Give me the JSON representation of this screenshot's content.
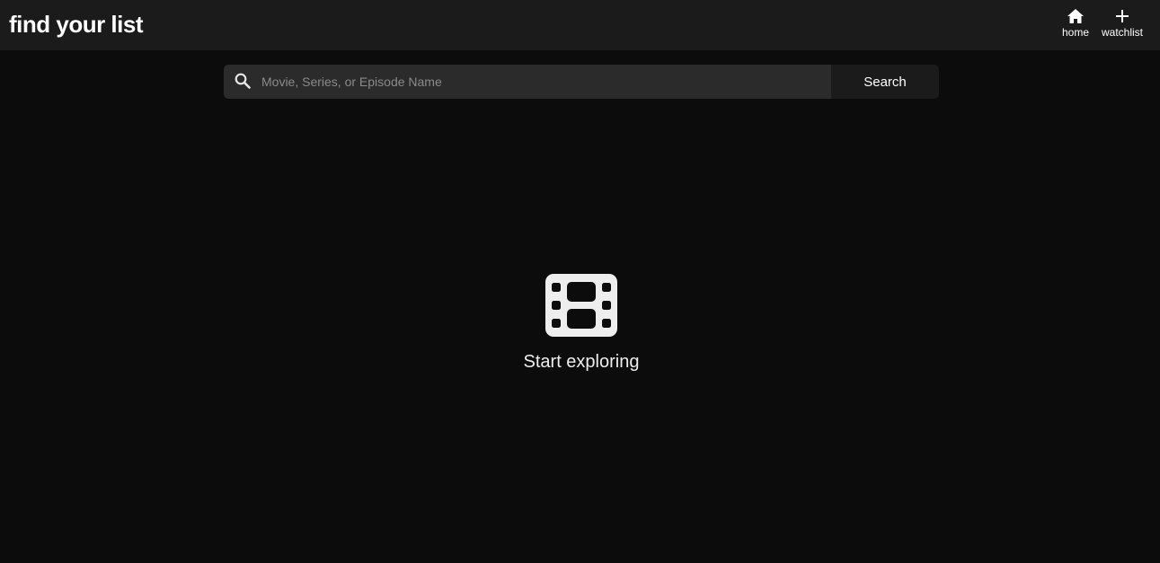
{
  "header": {
    "brand": "find your list",
    "nav": [
      {
        "label": "home",
        "icon": "home-icon"
      },
      {
        "label": "watchlist",
        "icon": "plus-icon"
      }
    ]
  },
  "search": {
    "placeholder": "Movie, Series, or Episode Name",
    "value": "",
    "button_label": "Search",
    "icon": "search-icon"
  },
  "empty_state": {
    "icon": "film-icon",
    "message": "Start exploring"
  },
  "colors": {
    "background": "#0c0c0c",
    "topbar": "#1b1b1b",
    "search_field": "#2b2b2b",
    "search_button": "#1b1b1b",
    "text": "#ffffff",
    "placeholder": "#8a8a8a",
    "icon": "#eeeeee"
  }
}
